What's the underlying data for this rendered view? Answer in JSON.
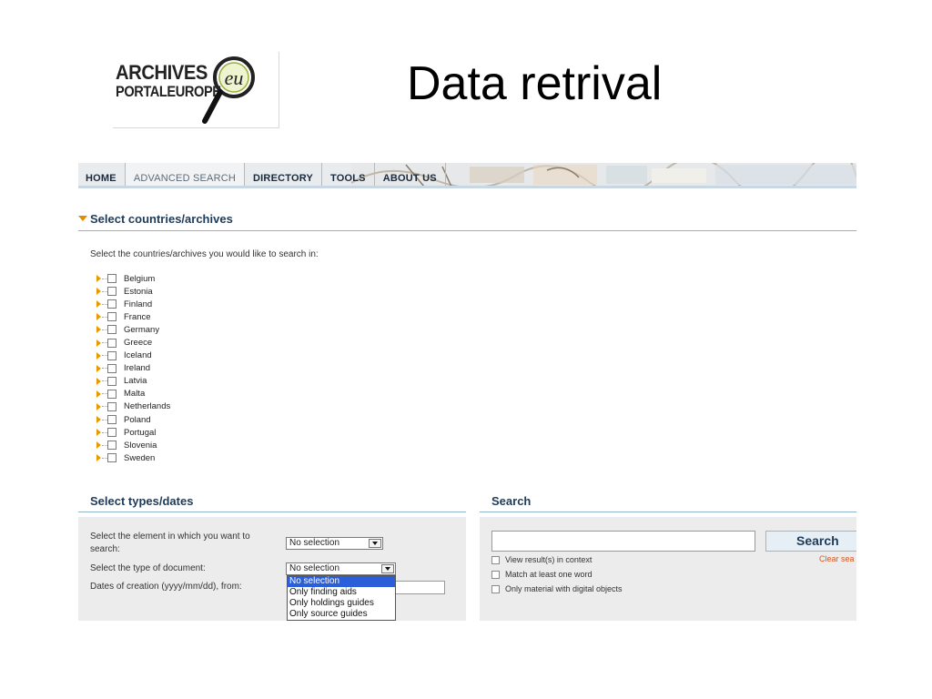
{
  "logo": {
    "line1": "ARCHIVES",
    "line2": "PORTALEUROPE",
    "emblem": "eu"
  },
  "slide_title": "Data retrival",
  "nav": {
    "tabs": [
      {
        "label": "HOME"
      },
      {
        "label": "ADVANCED SEARCH"
      },
      {
        "label": "DIRECTORY"
      },
      {
        "label": "TOOLS"
      },
      {
        "label": "ABOUT US"
      }
    ],
    "active_index": 1
  },
  "countries_section": {
    "title": "Select countries/archives",
    "instruction": "Select the countries/archives you would like to search in:",
    "items": [
      "Belgium",
      "Estonia",
      "Finland",
      "France",
      "Germany",
      "Greece",
      "Iceland",
      "Ireland",
      "Latvia",
      "Malta",
      "Netherlands",
      "Poland",
      "Portugal",
      "Slovenia",
      "Sweden"
    ]
  },
  "types_section": {
    "title": "Select types/dates",
    "element_label": "Select the element in which you want to search:",
    "element_value": "No selection",
    "doctype_label": "Select the type of document:",
    "doctype_value": "No selection",
    "dates_label": "Dates of creation (yyyy/mm/dd), from:",
    "doctype_options": [
      "No selection",
      "Only finding aids",
      "Only holdings guides",
      "Only source guides"
    ],
    "highlighted_option": 0
  },
  "search_section": {
    "title": "Search",
    "input_value": "",
    "button_label": "Search",
    "clear_label": "Clear sea",
    "options": [
      "View result(s) in context",
      "Match at least one word",
      "Only material with digital objects"
    ]
  },
  "colors": {
    "accent_orange": "#e88a00",
    "heading_blue": "#1f3b57",
    "highlight": "#2b5fd9"
  }
}
